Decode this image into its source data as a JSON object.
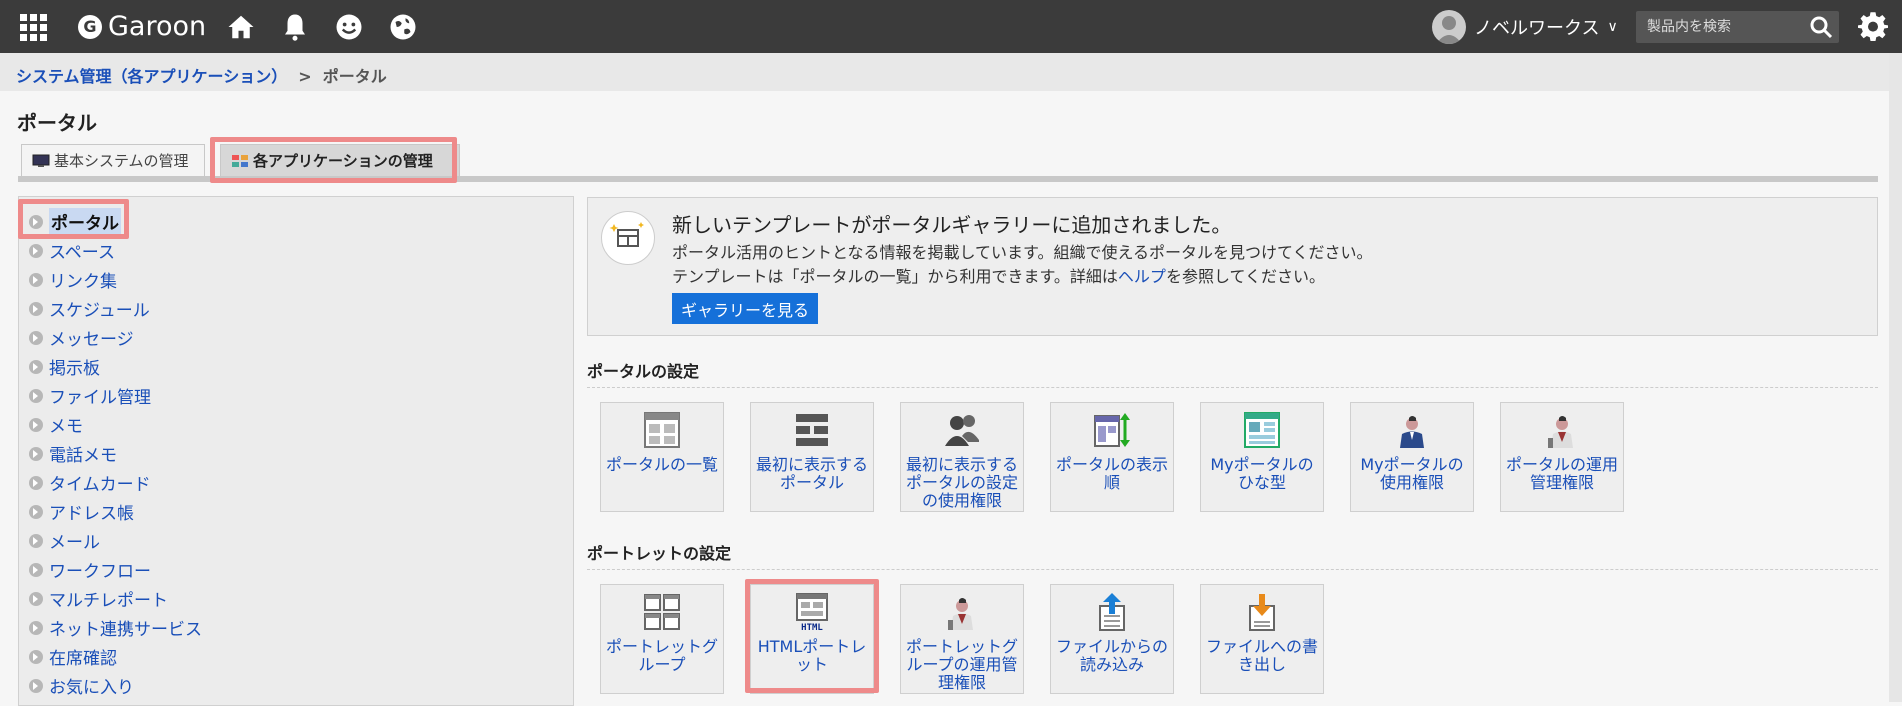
{
  "topbar": {
    "logo_text": "Garoon",
    "logo_letter": "G",
    "user_name": "ノベルワークス",
    "user_chevron": "∨",
    "search_placeholder": "製品内を検索"
  },
  "breadcrumb": {
    "parent": "システム管理（各アプリケーション）",
    "separator": ">",
    "current": "ポータル"
  },
  "page_title": "ポータル",
  "tabs": [
    {
      "label": "基本システムの管理"
    },
    {
      "label": "各アプリケーションの管理"
    }
  ],
  "leftnav": {
    "items": [
      {
        "label": "ポータル"
      },
      {
        "label": "スペース"
      },
      {
        "label": "リンク集"
      },
      {
        "label": "スケジュール"
      },
      {
        "label": "メッセージ"
      },
      {
        "label": "掲示板"
      },
      {
        "label": "ファイル管理"
      },
      {
        "label": "メモ"
      },
      {
        "label": "電話メモ"
      },
      {
        "label": "タイムカード"
      },
      {
        "label": "アドレス帳"
      },
      {
        "label": "メール"
      },
      {
        "label": "ワークフロー"
      },
      {
        "label": "マルチレポート"
      },
      {
        "label": "ネット連携サービス"
      },
      {
        "label": "在席確認"
      },
      {
        "label": "お気に入り"
      }
    ]
  },
  "notice": {
    "title": "新しいテンプレートがポータルギャラリーに追加されました。",
    "line1": "ポータル活用のヒントとなる情報を掲載しています。組織で使えるポータルを見つけてください。",
    "line2_prefix": "テンプレートは「ポータルの一覧」から利用できます。詳細は",
    "line2_link": "ヘルプ",
    "line2_suffix": "を参照してください。",
    "button": "ギャラリーを見る"
  },
  "portal_settings": {
    "title": "ポータルの設定",
    "cards": [
      {
        "label": "ポータルの一覧",
        "icon": "portal-list-icon"
      },
      {
        "label": "最初に表示するポータル",
        "icon": "default-portal-icon"
      },
      {
        "label": "最初に表示するポータルの設定の使用権限",
        "icon": "users-icon"
      },
      {
        "label": "ポータルの表示順",
        "icon": "display-order-icon"
      },
      {
        "label": "Myポータルのひな型",
        "icon": "my-portal-template-icon"
      },
      {
        "label": "Myポータルの使用権限",
        "icon": "person-icon"
      },
      {
        "label": "ポータルの運用管理権限",
        "icon": "admin-person-icon"
      }
    ]
  },
  "portlet_settings": {
    "title": "ポートレットの設定",
    "cards": [
      {
        "label": "ポートレットグループ",
        "icon": "portlet-group-icon"
      },
      {
        "label": "HTMLポートレット",
        "icon": "html-portlet-icon",
        "icon_text": "HTML"
      },
      {
        "label": "ポートレットグループの運用管理権限",
        "icon": "admin-person-icon"
      },
      {
        "label": "ファイルからの読み込み",
        "icon": "file-import-icon"
      },
      {
        "label": "ファイルへの書き出し",
        "icon": "file-export-icon"
      }
    ]
  },
  "colors": {
    "topbar": "#3b3b3b",
    "link": "#1a4fb8",
    "highlight": "#ee8a8a",
    "button": "#1570d9"
  }
}
